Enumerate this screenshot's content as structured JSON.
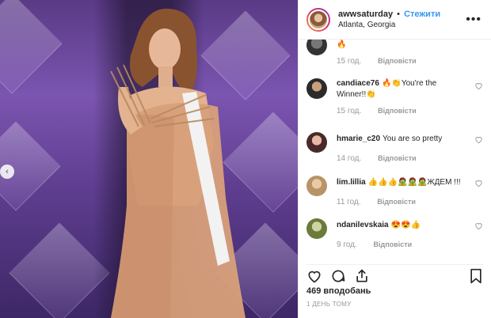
{
  "header": {
    "username": "awwsaturday",
    "dot": "•",
    "follow_label": "Стежити",
    "location": "Atlanta, Georgia",
    "more_label": "•••"
  },
  "photo": {
    "prev_glyph": "‹"
  },
  "comments": [
    {
      "username": "",
      "text": "🔥",
      "time": "15 год.",
      "reply": "Відповісти"
    },
    {
      "username": "candiace76",
      "text": "🔥👏You're the Winner!!👏",
      "time": "15 год.",
      "reply": "Відповісти"
    },
    {
      "username": "hmarie_c20",
      "text": "You are so pretty",
      "time": "14 год.",
      "reply": "Відповісти"
    },
    {
      "username": "lim.lillia",
      "text": "👍👍👍🧟🧟🧟ЖДЕМ !!!",
      "time": "11 год.",
      "reply": "Відповісти"
    },
    {
      "username": "ndanilevskaia",
      "text": "😍😍👍",
      "time": "9 год.",
      "reply": "Відповісти"
    }
  ],
  "likes": "469 вподобань",
  "timestamp": "1 ДЕНЬ ТОМУ",
  "colors": {
    "accent": "#3897f0",
    "text": "#262626",
    "muted": "#999999"
  }
}
